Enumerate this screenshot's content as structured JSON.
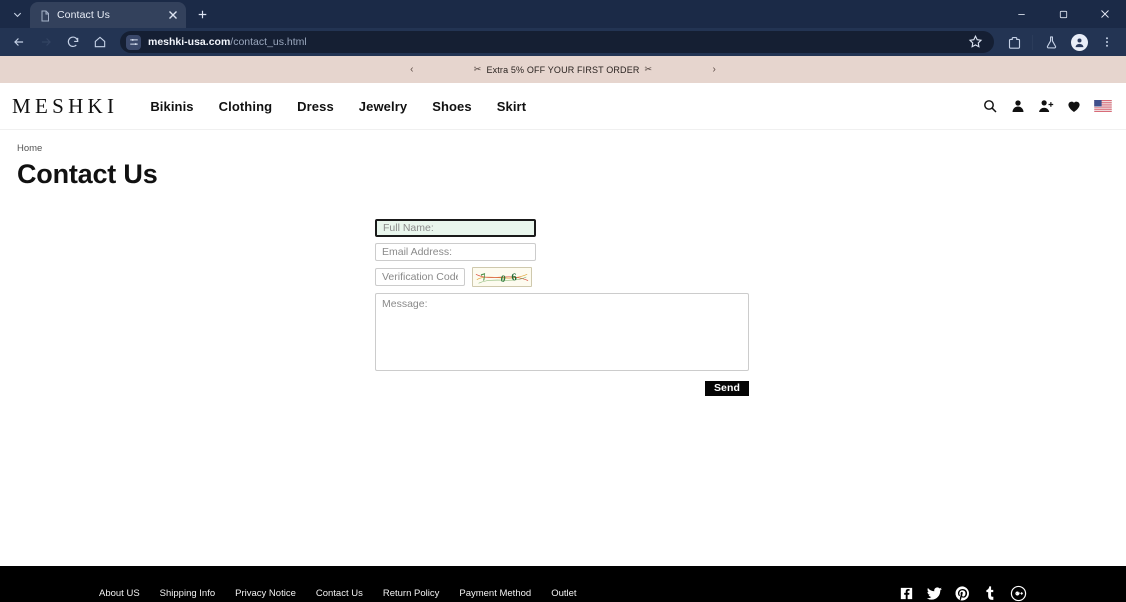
{
  "browser": {
    "tab": {
      "title": "Contact Us",
      "favicon_icon": "page-icon",
      "close_icon": "close-icon"
    },
    "tab_search_icon": "chevron-down-icon",
    "new_tab_icon": "plus-icon",
    "window_controls": {
      "minimize": "minimize-icon",
      "maximize": "maximize-icon",
      "close": "close-icon"
    },
    "toolbar": {
      "back_icon": "back-arrow-icon",
      "forward_icon": "forward-arrow-icon",
      "reload_icon": "reload-icon",
      "home_icon": "home-icon",
      "site_info_icon": "site-settings-icon",
      "url_domain": "meshki-usa.com",
      "url_path": "/contact_us.html",
      "bookmark_icon": "star-icon",
      "extensions_icon": "puzzle-icon",
      "labs_icon": "flask-icon",
      "profile_icon": "profile-avatar-icon",
      "menu_icon": "three-dot-menu-icon"
    }
  },
  "announcement": {
    "prev_icon": "chevron-left-icon",
    "next_icon": "chevron-right-icon",
    "text": "Extra 5% OFF YOUR FIRST ORDER",
    "spark_left": "✂",
    "spark_right": "✂"
  },
  "header": {
    "logo": "MESHKI",
    "nav": [
      {
        "label": "Bikinis"
      },
      {
        "label": "Clothing"
      },
      {
        "label": "Dress"
      },
      {
        "label": "Jewelry"
      },
      {
        "label": "Shoes"
      },
      {
        "label": "Skirt"
      }
    ],
    "actions": [
      {
        "name": "search-icon"
      },
      {
        "name": "account-icon"
      },
      {
        "name": "register-user-icon"
      },
      {
        "name": "wishlist-heart-icon"
      },
      {
        "name": "country-flag-us-icon"
      }
    ]
  },
  "page": {
    "breadcrumb": "Home",
    "title": "Contact Us"
  },
  "form": {
    "full_name": {
      "placeholder": "Full Name:",
      "value": "",
      "focused": true
    },
    "email": {
      "placeholder": "Email Address:",
      "value": ""
    },
    "verification": {
      "placeholder": "Verification Code",
      "value": ""
    },
    "captcha": {
      "text": "706",
      "alt": "captcha-image"
    },
    "message": {
      "placeholder": "Message:",
      "value": ""
    },
    "submit_label": "Send"
  },
  "footer": {
    "links": [
      {
        "label": "About US"
      },
      {
        "label": "Shipping Info"
      },
      {
        "label": "Privacy Notice"
      },
      {
        "label": "Contact Us"
      },
      {
        "label": "Return Policy"
      },
      {
        "label": "Payment Method"
      },
      {
        "label": "Outlet"
      }
    ],
    "social": [
      {
        "name": "facebook-icon"
      },
      {
        "name": "twitter-icon"
      },
      {
        "name": "pinterest-icon"
      },
      {
        "name": "tumblr-icon"
      },
      {
        "name": "google-plus-icon"
      }
    ]
  },
  "colors": {
    "announcement_bg": "#e6d5ce",
    "footer_bg": "#000000",
    "focus_field_bg": "#e9f6ed",
    "button_bg": "#050505"
  }
}
